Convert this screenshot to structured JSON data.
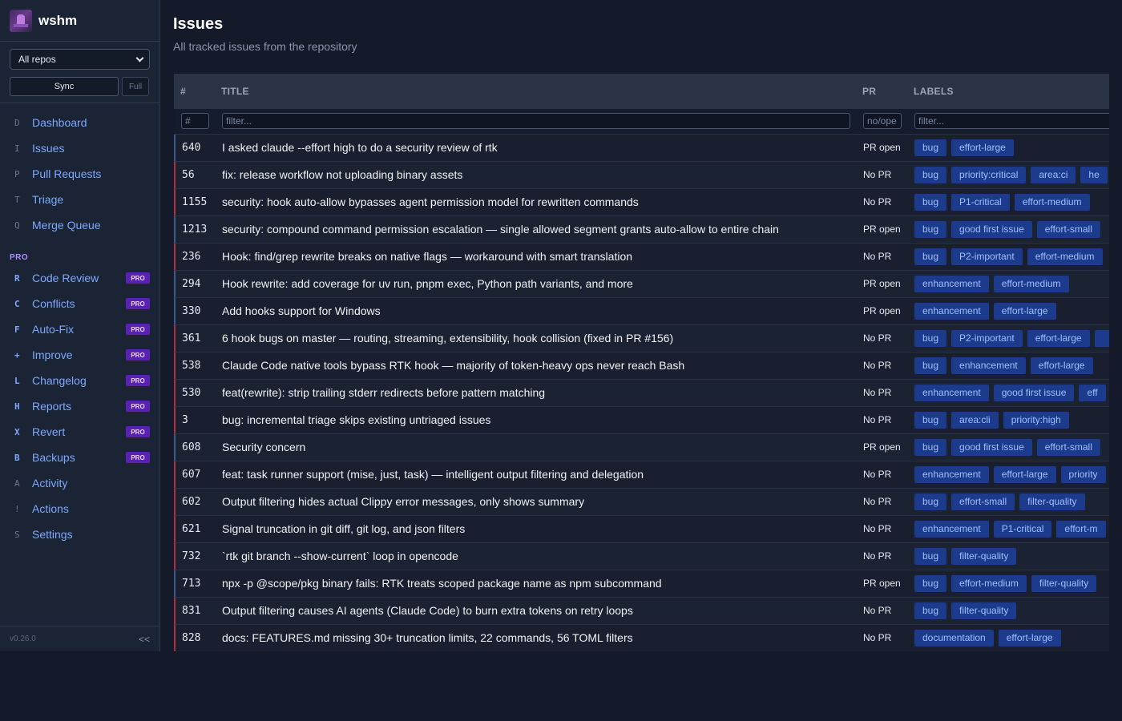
{
  "app": {
    "name": "wshm",
    "version": "v0.26.0",
    "collapse": "<<"
  },
  "controls": {
    "repo": "All repos",
    "sync": "Sync",
    "full": "Full"
  },
  "nav": [
    {
      "key": "D",
      "label": "Dashboard"
    },
    {
      "key": "I",
      "label": "Issues"
    },
    {
      "key": "P",
      "label": "Pull Requests"
    },
    {
      "key": "T",
      "label": "Triage"
    },
    {
      "key": "Q",
      "label": "Merge Queue"
    }
  ],
  "pro_section": "PRO",
  "pro_badge": "PRO",
  "pro_nav": [
    {
      "key": "R",
      "label": "Code Review",
      "pro": true
    },
    {
      "key": "C",
      "label": "Conflicts",
      "pro": true
    },
    {
      "key": "F",
      "label": "Auto-Fix",
      "pro": true
    },
    {
      "key": "+",
      "label": "Improve",
      "pro": true
    },
    {
      "key": "L",
      "label": "Changelog",
      "pro": true
    },
    {
      "key": "H",
      "label": "Reports",
      "pro": true
    },
    {
      "key": "X",
      "label": "Revert",
      "pro": true
    },
    {
      "key": "B",
      "label": "Backups",
      "pro": true
    },
    {
      "key": "A",
      "label": "Activity",
      "pro": false
    },
    {
      "key": "!",
      "label": "Actions",
      "pro": false
    },
    {
      "key": "S",
      "label": "Settings",
      "pro": false
    }
  ],
  "page": {
    "title": "Issues",
    "subtitle": "All tracked issues from the repository"
  },
  "table": {
    "headers": {
      "num": "#",
      "title": "TITLE",
      "pr": "PR",
      "labels": "LABELS"
    },
    "filters": {
      "num": "#",
      "title": "filter...",
      "pr": "no/ope",
      "labels": "filter..."
    },
    "rows": [
      {
        "num": "640",
        "title": "I asked claude --effort high to do a security review of rtk",
        "pr": "PR open",
        "labels": [
          "bug",
          "effort-large"
        ]
      },
      {
        "num": "56",
        "title": "fix: release workflow not uploading binary assets",
        "pr": "No PR",
        "labels": [
          "bug",
          "priority:critical",
          "area:ci",
          "he"
        ]
      },
      {
        "num": "1155",
        "title": "security: hook auto-allow bypasses agent permission model for rewritten commands",
        "pr": "No PR",
        "labels": [
          "bug",
          "P1-critical",
          "effort-medium"
        ]
      },
      {
        "num": "1213",
        "title": "security: compound command permission escalation — single allowed segment grants auto-allow to entire chain",
        "pr": "PR open",
        "labels": [
          "bug",
          "good first issue",
          "effort-small"
        ]
      },
      {
        "num": "236",
        "title": "Hook: find/grep rewrite breaks on native flags — workaround with smart translation",
        "pr": "No PR",
        "labels": [
          "bug",
          "P2-important",
          "effort-medium"
        ]
      },
      {
        "num": "294",
        "title": "Hook rewrite: add coverage for uv run, pnpm exec, Python path variants, and more",
        "pr": "PR open",
        "labels": [
          "enhancement",
          "effort-medium"
        ]
      },
      {
        "num": "330",
        "title": "Add hooks support for Windows",
        "pr": "PR open",
        "labels": [
          "enhancement",
          "effort-large"
        ]
      },
      {
        "num": "361",
        "title": "6 hook bugs on master — routing, streaming, extensibility, hook collision (fixed in PR #156)",
        "pr": "No PR",
        "labels": [
          "bug",
          "P2-important",
          "effort-large",
          ""
        ]
      },
      {
        "num": "538",
        "title": "Claude Code native tools bypass RTK hook — majority of token-heavy ops never reach Bash",
        "pr": "No PR",
        "labels": [
          "bug",
          "enhancement",
          "effort-large"
        ]
      },
      {
        "num": "530",
        "title": "feat(rewrite): strip trailing stderr redirects before pattern matching",
        "pr": "No PR",
        "labels": [
          "enhancement",
          "good first issue",
          "eff"
        ]
      },
      {
        "num": "3",
        "title": "bug: incremental triage skips existing untriaged issues",
        "pr": "No PR",
        "labels": [
          "bug",
          "area:cli",
          "priority:high"
        ]
      },
      {
        "num": "608",
        "title": "Security concern",
        "pr": "PR open",
        "labels": [
          "bug",
          "good first issue",
          "effort-small"
        ]
      },
      {
        "num": "607",
        "title": "feat: task runner support (mise, just, task) — intelligent output filtering and delegation",
        "pr": "No PR",
        "labels": [
          "enhancement",
          "effort-large",
          "priority"
        ]
      },
      {
        "num": "602",
        "title": "Output filtering hides actual Clippy error messages, only shows summary",
        "pr": "No PR",
        "labels": [
          "bug",
          "effort-small",
          "filter-quality"
        ]
      },
      {
        "num": "621",
        "title": "Signal truncation in git diff, git log, and json filters",
        "pr": "No PR",
        "labels": [
          "enhancement",
          "P1-critical",
          "effort-m"
        ]
      },
      {
        "num": "732",
        "title": "`rtk git branch --show-current` loop in opencode",
        "pr": "No PR",
        "labels": [
          "bug",
          "filter-quality"
        ]
      },
      {
        "num": "713",
        "title": "npx -p @scope/pkg binary fails: RTK treats scoped package name as npm subcommand",
        "pr": "PR open",
        "labels": [
          "bug",
          "effort-medium",
          "filter-quality"
        ]
      },
      {
        "num": "831",
        "title": "Output filtering causes AI agents (Claude Code) to burn extra tokens on retry loops",
        "pr": "No PR",
        "labels": [
          "bug",
          "filter-quality"
        ]
      },
      {
        "num": "828",
        "title": "docs: FEATURES.md missing 30+ truncation limits, 22 commands, 56 TOML filters",
        "pr": "No PR",
        "labels": [
          "documentation",
          "effort-large"
        ]
      }
    ]
  }
}
